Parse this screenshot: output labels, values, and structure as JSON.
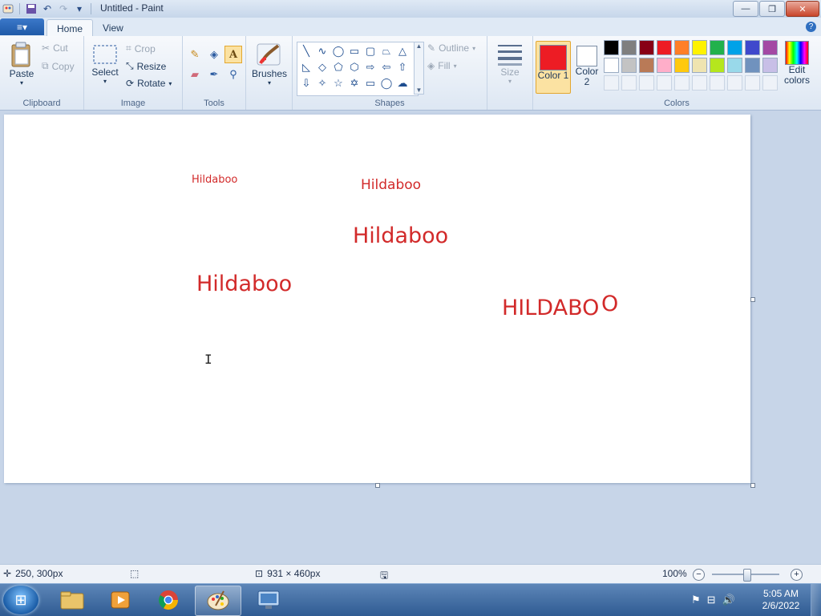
{
  "window": {
    "title": "Untitled - Paint",
    "minimize": "—",
    "maximize": "❐",
    "close": "✕"
  },
  "quick_access": {
    "app_icon": "paint-app-icon",
    "save": "save-icon",
    "undo": "undo-icon",
    "redo": "redo-icon",
    "customize": "dropdown-icon"
  },
  "tabs": {
    "file": "≡▾",
    "home": "Home",
    "view": "View",
    "help": "?"
  },
  "clipboard": {
    "label": "Clipboard",
    "paste": "Paste",
    "cut": "Cut",
    "copy": "Copy"
  },
  "image": {
    "label": "Image",
    "select": "Select",
    "crop": "Crop",
    "resize": "Resize",
    "rotate": "Rotate"
  },
  "tools": {
    "label": "Tools",
    "items": [
      "pencil-icon",
      "fill-icon",
      "text-icon",
      "eraser-icon",
      "color-picker-icon",
      "magnifier-icon"
    ],
    "selected": "text-icon"
  },
  "brushes": {
    "label": "Brushes"
  },
  "shapes": {
    "label": "Shapes",
    "outline": "Outline",
    "fill": "Fill",
    "items": [
      "line",
      "curve",
      "oval",
      "rectangle",
      "rounded-rectangle",
      "polygon",
      "triangle",
      "right-triangle",
      "diamond",
      "pentagon",
      "hexagon",
      "right-arrow",
      "left-arrow",
      "up-arrow",
      "down-arrow",
      "four-point-star",
      "five-point-star",
      "six-point-star",
      "rounded-callout",
      "oval-callout",
      "cloud-callout"
    ]
  },
  "size": {
    "label": "Size"
  },
  "colors": {
    "label": "Colors",
    "color1_label": "Color 1",
    "color2_label": "Color 2",
    "color1": "#ed1c24",
    "color2": "#ffffff",
    "edit_colors": "Edit colors",
    "palette_row1": [
      "#000000",
      "#7f7f7f",
      "#880015",
      "#ed1c24",
      "#ff7f27",
      "#fff200",
      "#22b14c",
      "#00a2e8",
      "#3f48cc",
      "#a349a4"
    ],
    "palette_row2": [
      "#ffffff",
      "#c3c3c3",
      "#b97a57",
      "#ffaec9",
      "#ffc90e",
      "#efe4b0",
      "#b5e61d",
      "#99d9ea",
      "#7092be",
      "#c8bfe7"
    ]
  },
  "canvas_texts": [
    "Hildaboo",
    "Hildaboo",
    "Hildaboo",
    "Hildaboo",
    "HILDABO",
    "O"
  ],
  "status": {
    "cursor_pos": "250, 300px",
    "canvas_size": "931 × 460px",
    "zoom": "100%"
  },
  "taskbar": {
    "time": "5:05 AM",
    "date": "2/6/2022"
  }
}
